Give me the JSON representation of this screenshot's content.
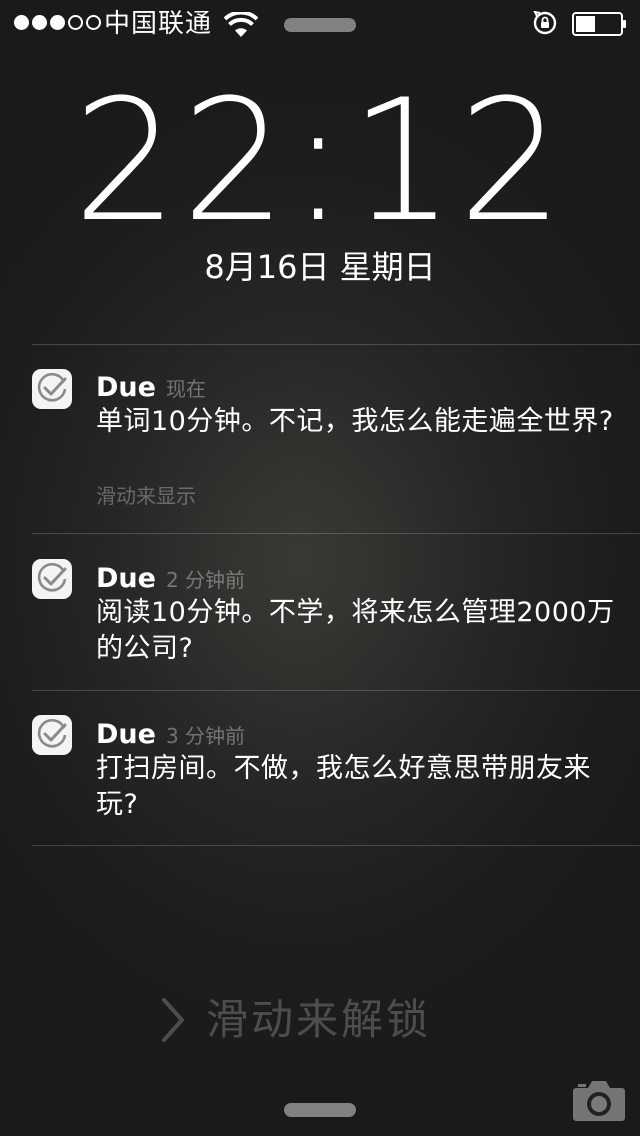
{
  "status_bar": {
    "signal_bars": 3,
    "signal_total": 5,
    "carrier": "中国联通",
    "battery_level": 0.45
  },
  "lock_screen": {
    "time": "22:12",
    "date": "8月16日 星期日"
  },
  "notifications": [
    {
      "app": "Due",
      "time": "现在",
      "body": "单词10分钟。不记，我怎么能走遍全世界?",
      "hint": "滑动来显示",
      "icon": "checkmark-icon"
    },
    {
      "app": "Due",
      "time": "2 分钟前",
      "body": "阅读10分钟。不学，将来怎么管理2000万的公司?",
      "icon": "checkmark-icon"
    },
    {
      "app": "Due",
      "time": "3 分钟前",
      "body": "打扫房间。不做，我怎么好意思带朋友来玩?",
      "icon": "checkmark-icon"
    }
  ],
  "unlock": {
    "label": "滑动来解锁"
  },
  "colors": {
    "text": "#ffffff",
    "icon_bg": "#f4f4f4",
    "check": "#8a8a8a"
  }
}
